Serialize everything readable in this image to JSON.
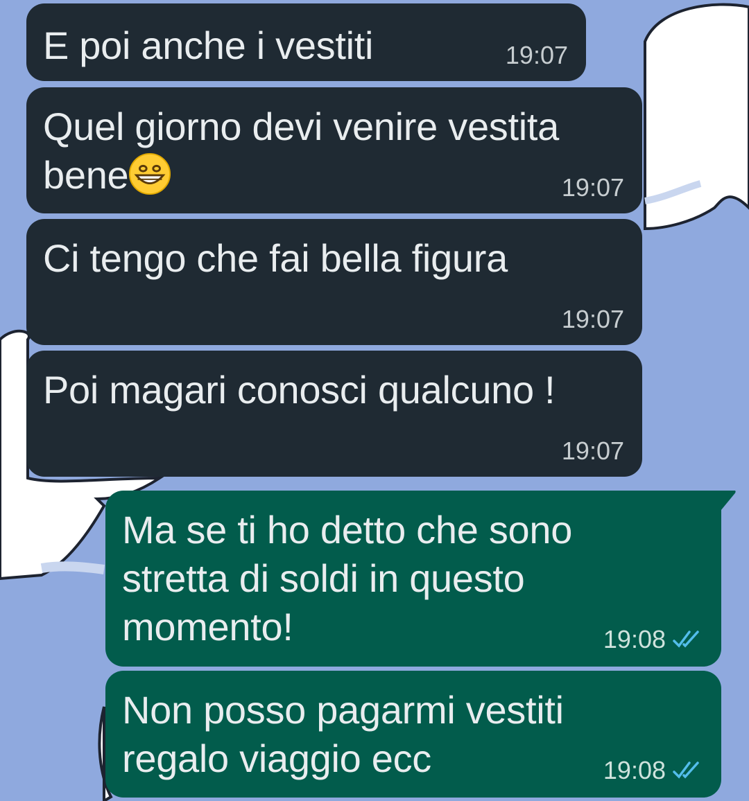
{
  "messages": [
    {
      "direction": "incoming",
      "text": "E poi anche i vestiti",
      "time": "19:07"
    },
    {
      "direction": "incoming",
      "text": "Quel giorno devi venire vestita",
      "text2": "bene",
      "emoji": "grinning-face-emoji",
      "time": "19:07"
    },
    {
      "direction": "incoming",
      "text": "Ci tengo che fai bella figura",
      "time": "19:07"
    },
    {
      "direction": "incoming",
      "text": "Poi magari conosci qualcuno !",
      "time": "19:07"
    },
    {
      "direction": "outgoing",
      "text": "Ma se ti ho detto che sono\nstretta di soldi in questo\nmomento!",
      "time": "19:08",
      "status": "double-check-read-icon"
    },
    {
      "direction": "outgoing",
      "text": "Non posso pagarmi vestiti\nregalo viaggio ecc",
      "time": "19:08",
      "status": "double-check-read-icon"
    }
  ],
  "colors": {
    "wallpaper": "#8fa9de",
    "incoming_bubble": "#1f2a33",
    "outgoing_bubble": "#025c4c",
    "read_tick": "#53bdeb"
  }
}
